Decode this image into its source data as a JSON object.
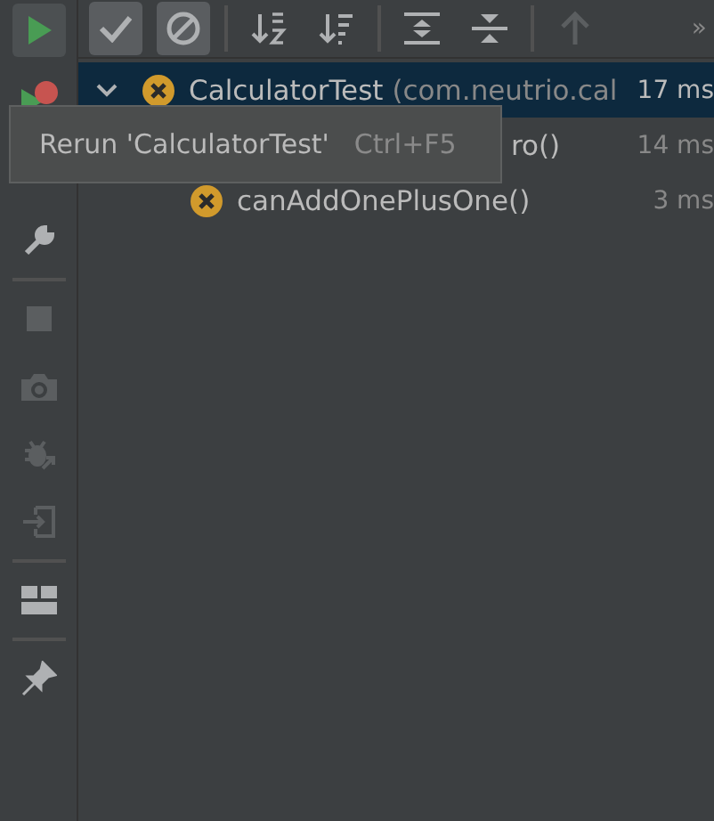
{
  "side_toolbar": [
    {
      "kind": "rerun",
      "selected": true
    },
    {
      "kind": "rerun-failed"
    },
    {
      "kind": "wrench"
    },
    {
      "kind": "divider"
    },
    {
      "kind": "stop",
      "disabled": true
    },
    {
      "kind": "camera",
      "disabled": true
    },
    {
      "kind": "bug",
      "disabled": true
    },
    {
      "kind": "import",
      "disabled": true
    },
    {
      "kind": "divider"
    },
    {
      "kind": "layout"
    },
    {
      "kind": "divider"
    },
    {
      "kind": "pin"
    }
  ],
  "top_toolbar": [
    {
      "kind": "check",
      "selected": true
    },
    {
      "kind": "ignored",
      "selected": true
    },
    {
      "kind": "divider"
    },
    {
      "kind": "sort-alpha",
      "selected": false
    },
    {
      "kind": "sort-duration",
      "selected": false
    },
    {
      "kind": "divider"
    },
    {
      "kind": "expand",
      "selected": false
    },
    {
      "kind": "collapse",
      "selected": false
    },
    {
      "kind": "divider"
    },
    {
      "kind": "up",
      "selected": false,
      "disabled": true
    },
    {
      "kind": "more",
      "text": "»"
    }
  ],
  "tree": [
    {
      "name": "CalculatorTest",
      "detail": "(com.neutrio.cal",
      "time": "17 ms",
      "expanded": true,
      "selected": true,
      "children": [
        {
          "kind": "partial",
          "name": "ro()",
          "time": "14 ms",
          "selected": false
        },
        {
          "kind": "test",
          "name": "canAddOnePlusOne()",
          "time": "3 ms",
          "selected": false
        }
      ]
    }
  ],
  "tooltip": {
    "text": "Rerun 'CalculatorTest'",
    "shortcut": "Ctrl+F5"
  }
}
